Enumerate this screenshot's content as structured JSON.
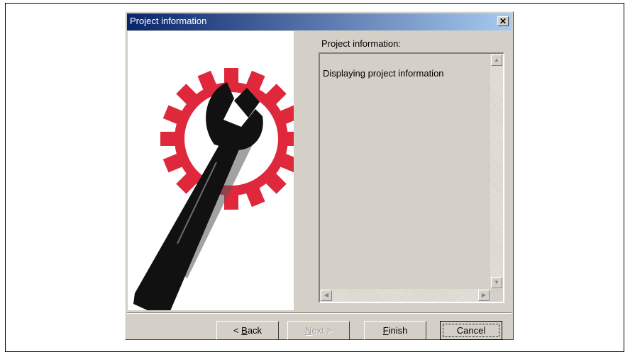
{
  "window": {
    "title": "Project information",
    "close_glyph": "✕",
    "close_icon": "close-icon"
  },
  "graphic": {
    "icon": "wrench-gear-icon",
    "colors": {
      "gear": "#e0283c",
      "wrench": "#111111"
    }
  },
  "content": {
    "label": "Project information:",
    "text": "Displaying project information"
  },
  "scrollbar": {
    "up": "▲",
    "down": "▼",
    "left": "◀",
    "right": "▶"
  },
  "buttons": {
    "back": {
      "prefix": "< ",
      "mnemonic": "B",
      "rest": "ack",
      "enabled": true
    },
    "next": {
      "mnemonic": "N",
      "rest": "ext",
      "suffix": " >",
      "enabled": false
    },
    "finish": {
      "mnemonic": "F",
      "rest": "inish",
      "enabled": true
    },
    "cancel": {
      "label": "Cancel",
      "enabled": true,
      "default": true
    }
  },
  "colors": {
    "title_start": "#0a246a",
    "title_end": "#a6caf0",
    "face": "#d4d0c8"
  }
}
